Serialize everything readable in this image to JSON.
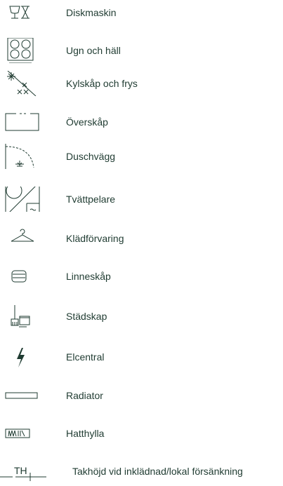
{
  "legend": {
    "items": [
      {
        "icon": "dishwasher-icon",
        "label": "Diskmaskin"
      },
      {
        "icon": "stove-oven-icon",
        "label": "Ugn och häll"
      },
      {
        "icon": "fridge-freezer-icon",
        "label": "Kylskåp och frys"
      },
      {
        "icon": "upper-cabinet-icon",
        "label": "Överskåp"
      },
      {
        "icon": "shower-wall-icon",
        "label": "Duschvägg"
      },
      {
        "icon": "washer-dryer-tower-icon",
        "label": "Tvättpelare"
      },
      {
        "icon": "clothes-hanger-icon",
        "label": "Klädförvaring"
      },
      {
        "icon": "linen-cabinet-icon",
        "label": "Linneskåp"
      },
      {
        "icon": "cleaning-cabinet-icon",
        "label": "Städskap"
      },
      {
        "icon": "lightning-bolt-icon",
        "label": "Elcentral"
      },
      {
        "icon": "radiator-icon",
        "label": "Radiator"
      },
      {
        "icon": "hat-shelf-icon",
        "label": "Hatthylla"
      },
      {
        "icon": "ceiling-height-icon",
        "icon_text": "TH",
        "label": "Takhöjd vid inklädnad/lokal försänkning"
      }
    ]
  },
  "colors": {
    "ink": "#1f3b31"
  }
}
